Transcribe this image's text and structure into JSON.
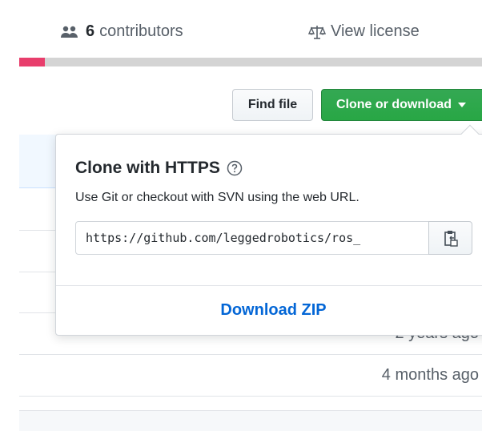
{
  "summary": {
    "contributors_count": "6",
    "contributors_label": "contributors",
    "license_label": "View license"
  },
  "language_bar": {
    "primary_color": "#e83e6c",
    "rest_color": "#d4d4d4",
    "primary_fraction": 0.055
  },
  "buttons": {
    "find_file": "Find file",
    "clone": "Clone or download"
  },
  "clone_panel": {
    "title": "Clone with HTTPS",
    "description": "Use Git or checkout with SVN using the web URL.",
    "url": "https://github.com/leggedrobotics/ros_",
    "download_zip": "Download ZIP"
  },
  "file_rows": [
    {
      "age": ""
    },
    {
      "age": ""
    },
    {
      "age": ""
    },
    {
      "age": ""
    },
    {
      "age": "2 years ago"
    },
    {
      "age": "4 months ago"
    }
  ],
  "colors": {
    "clone_green": "#28a745",
    "link_blue": "#0366d6"
  }
}
